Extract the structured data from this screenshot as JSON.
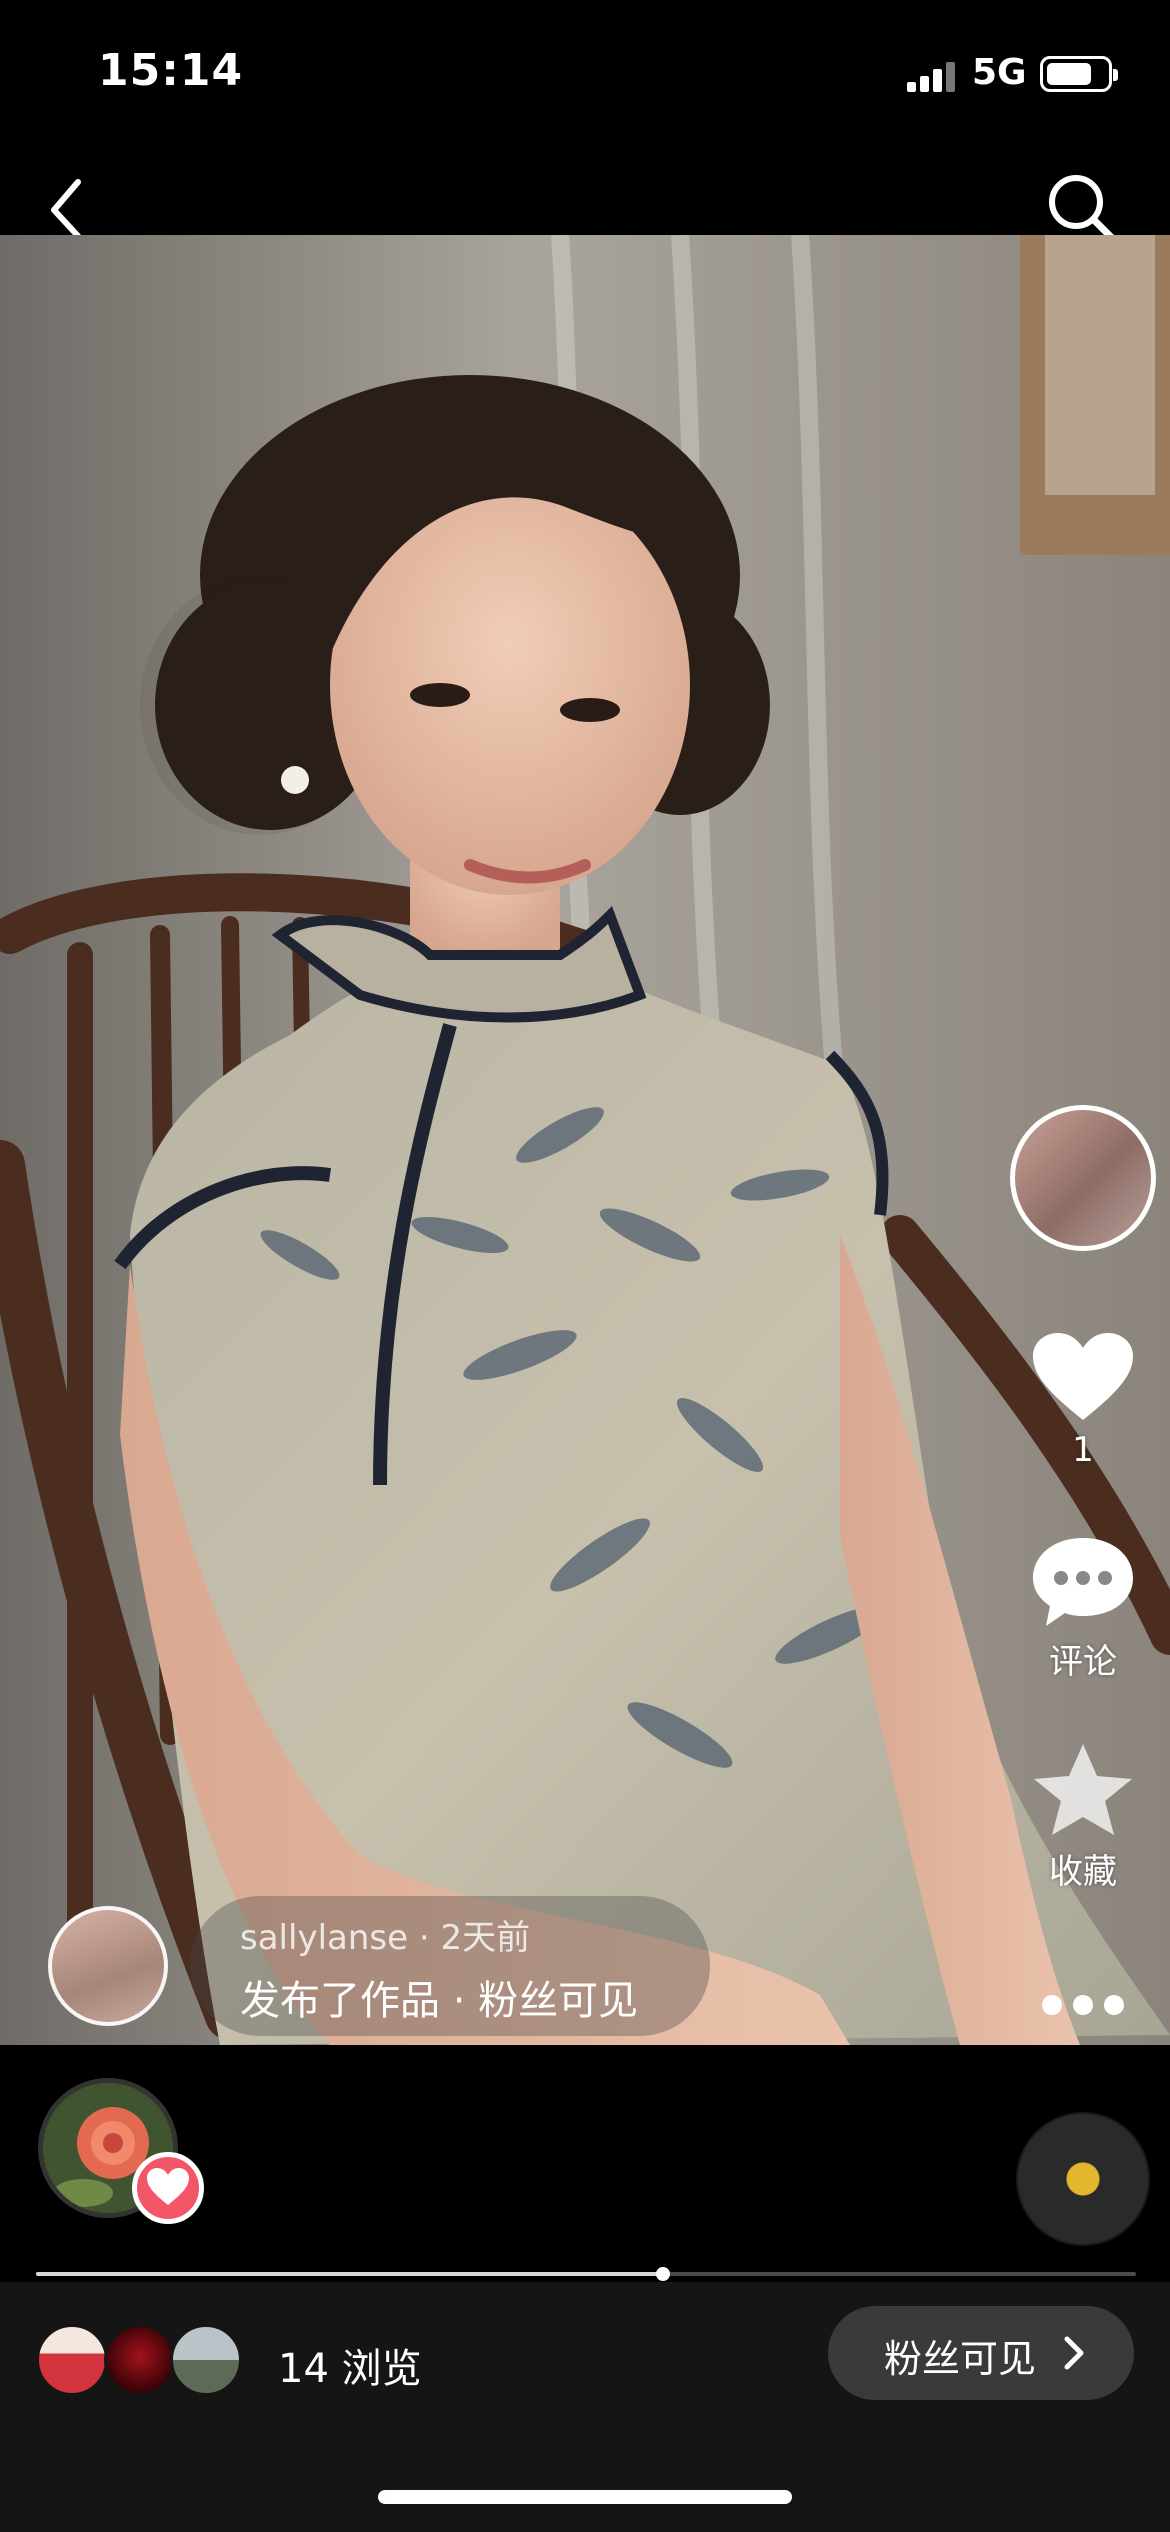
{
  "status_bar": {
    "time": "15:14",
    "network": "5G"
  },
  "top_nav": {
    "back_icon": "chevron-left-icon",
    "search_icon": "search-icon"
  },
  "post": {
    "username": "sallylanse · 2天前",
    "caption": "发布了作品 · 粉丝可见"
  },
  "actions": {
    "like_count": "1",
    "comment_label": "评论",
    "favorite_label": "收藏",
    "more_icon": "more-dots-icon"
  },
  "progress": {
    "fraction": 0.57
  },
  "footer": {
    "views": "14 浏览",
    "audience_button": "粉丝可见"
  },
  "colors": {
    "heart_badge": "#f25668",
    "disc_center": "#e2b62e",
    "button_bg": "#3a3a3a"
  }
}
